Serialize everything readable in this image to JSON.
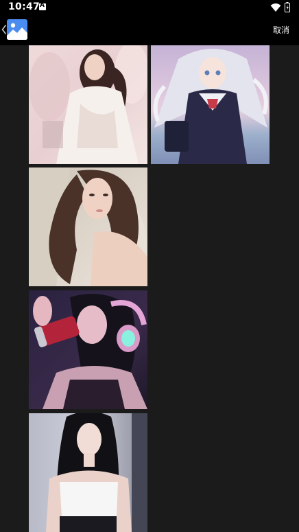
{
  "status_bar": {
    "time": "10:47"
  },
  "app_bar": {
    "cancel_label": "取消"
  },
  "photos": [
    {
      "name": "photo-1"
    },
    {
      "name": "photo-2"
    },
    {
      "name": "photo-3"
    },
    {
      "name": "photo-4"
    },
    {
      "name": "photo-5"
    }
  ],
  "colors": {
    "background": "#1b1b1b",
    "bar": "#000000",
    "accent_icon": "#4a8cf0"
  }
}
